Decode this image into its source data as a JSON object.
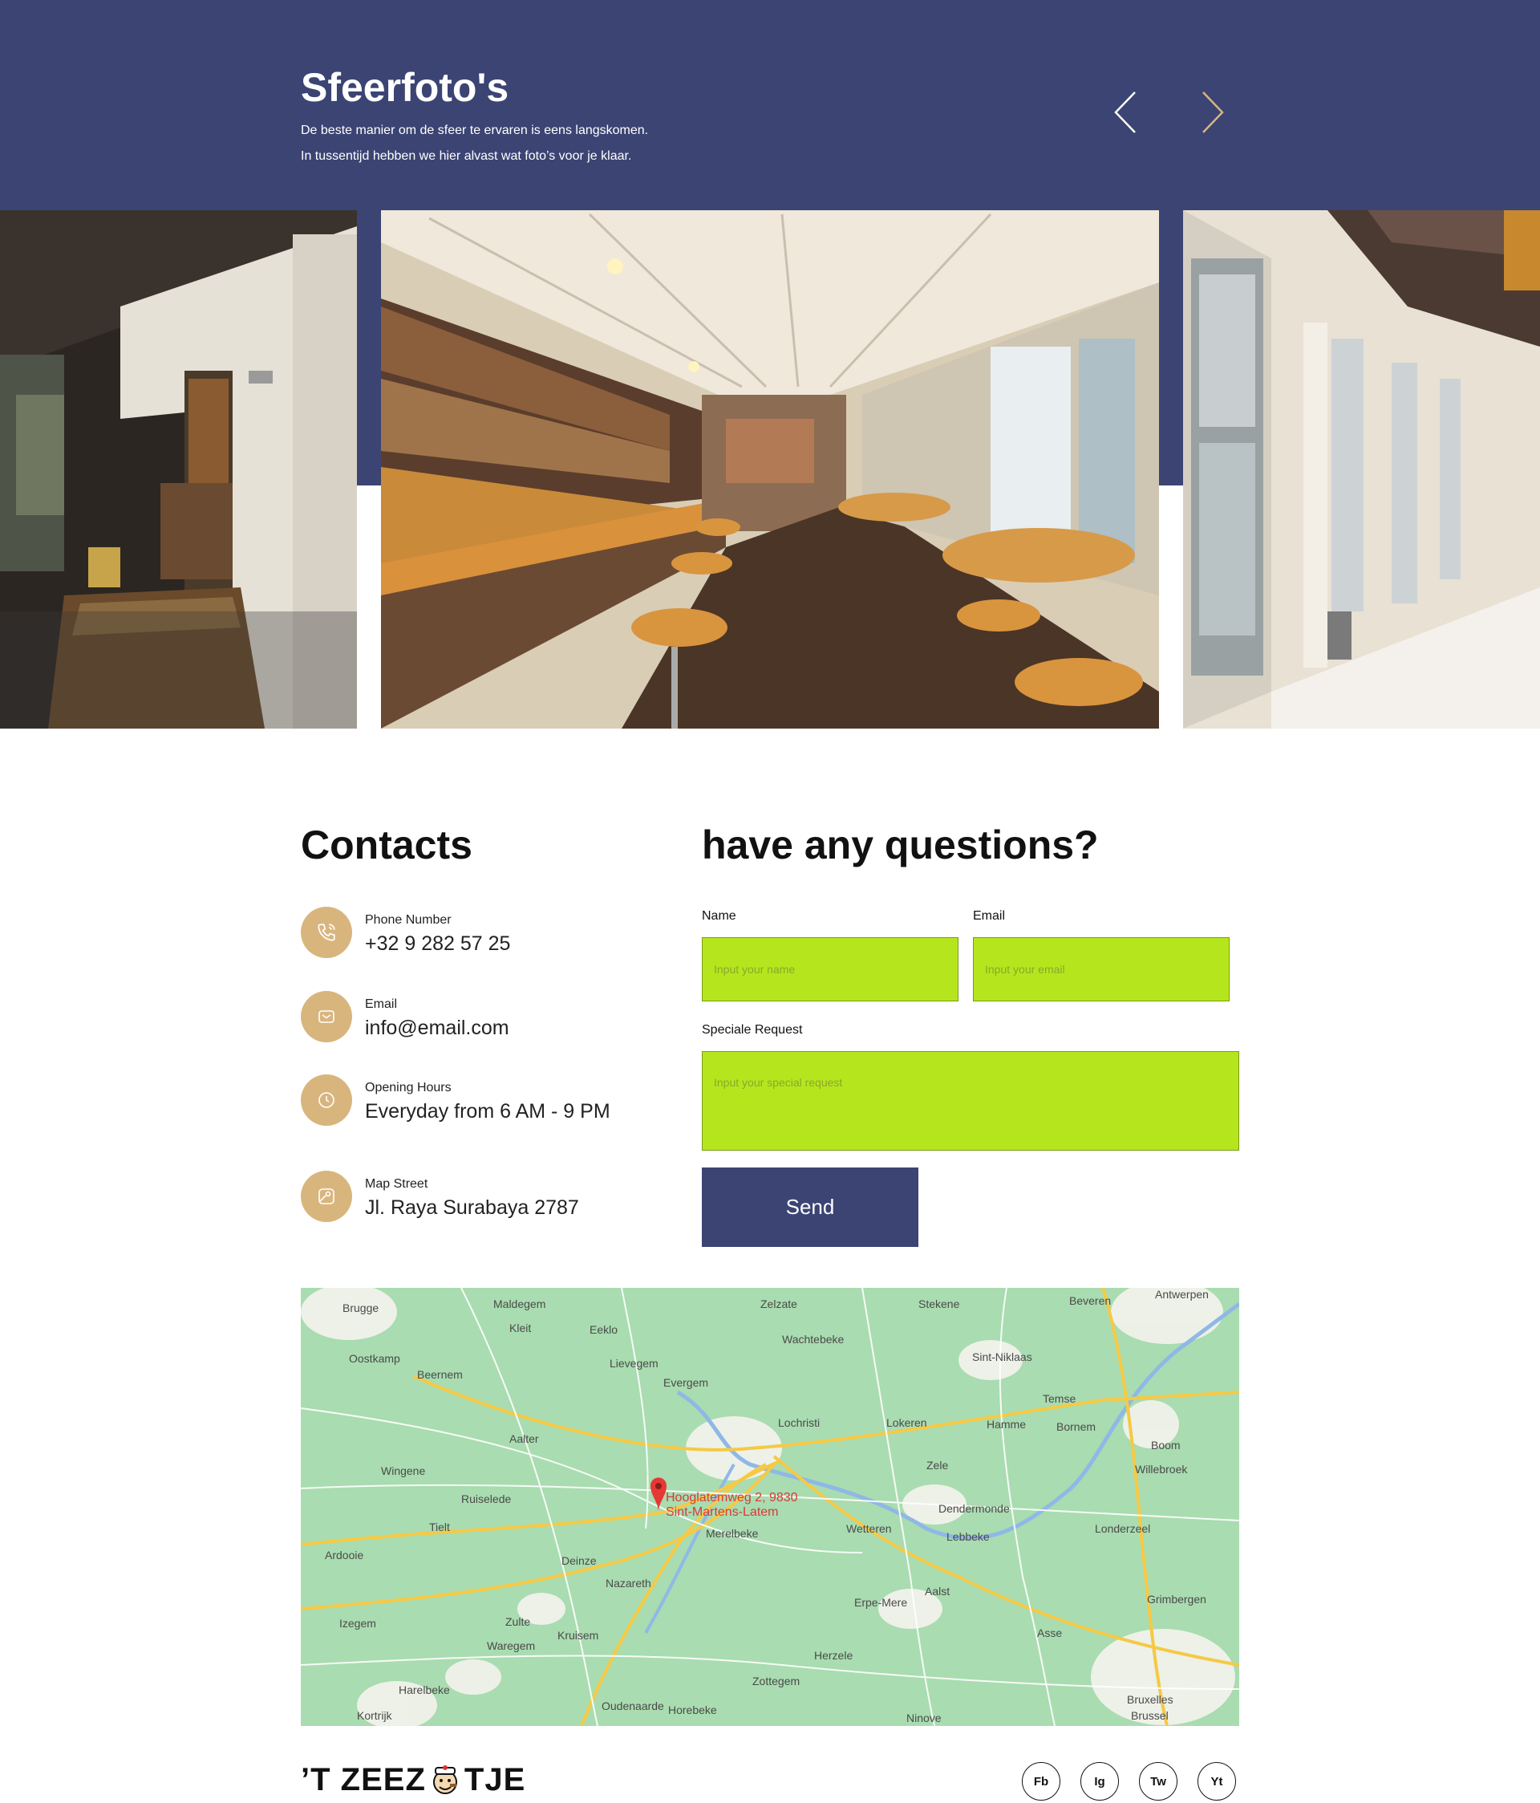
{
  "gallery": {
    "title": "Sfeerfoto's",
    "subtitle_line1": "De beste manier om de sfeer te ervaren is eens langskomen.",
    "subtitle_line2": "In tussentijd hebben we hier alvast wat foto’s voor je klaar."
  },
  "contacts": {
    "title": "Contacts",
    "items": [
      {
        "label": "Phone Number",
        "value": "+32 9 282 57 25",
        "icon": "phone-icon"
      },
      {
        "label": "Email",
        "value": "info@email.com",
        "icon": "mail-icon"
      },
      {
        "label": "Opening Hours",
        "value": "Everyday from 6 AM - 9 PM",
        "icon": "clock-icon"
      },
      {
        "label": "Map Street",
        "value": "Jl. Raya Surabaya 2787",
        "icon": "map-icon"
      }
    ]
  },
  "form": {
    "title": "have any questions?",
    "name_label": "Name",
    "name_placeholder": "Input your name",
    "email_label": "Email",
    "email_placeholder": "Input your email",
    "request_label": "Speciale Request",
    "request_placeholder": "Input your special request",
    "send_label": "Send"
  },
  "map": {
    "pin_line1": "Hooglatemweg 2, 9830",
    "pin_line2": "Sint-Martens-Latem",
    "places": [
      "Brugge",
      "Maldegem",
      "Zelzate",
      "Stekene",
      "Antwerpen",
      "Beveren",
      "Eeklo",
      "Kleit",
      "Wachtebeke",
      "Sint-Niklaas",
      "Oostkamp",
      "Beernem",
      "Lievegem",
      "Evergem",
      "Temse",
      "Lochristi",
      "Lokeren",
      "Hamme",
      "Bornem",
      "Aalter",
      "Zele",
      "Boom",
      "Wingene",
      "Willebroek",
      "Ruiselede",
      "Dendermonde",
      "Tielt",
      "Lebbeke",
      "Wetteren",
      "Londerzeel",
      "Merelbeke",
      "Deinze",
      "Nazareth",
      "Aalst",
      "Grimbergen",
      "Erpe-Mere",
      "Zulte",
      "Waregem",
      "Kruisem",
      "Asse",
      "Herzele",
      "Harelbeke",
      "Zottegem",
      "Oudenaarde",
      "Horebeke",
      "Ninove",
      "Bruxelles",
      "Brussel",
      "Kortrijk",
      "Izegem",
      "Ardooie"
    ]
  },
  "footer": {
    "logo_left": "’T ZEEZ",
    "logo_right": "TJE",
    "social": [
      "Fb",
      "Ig",
      "Tw",
      "Yt"
    ]
  },
  "colors": {
    "navy": "#3b4473",
    "gold": "#d9b57e",
    "lime": "#b5e61d",
    "map_green": "#a9dcb0"
  }
}
